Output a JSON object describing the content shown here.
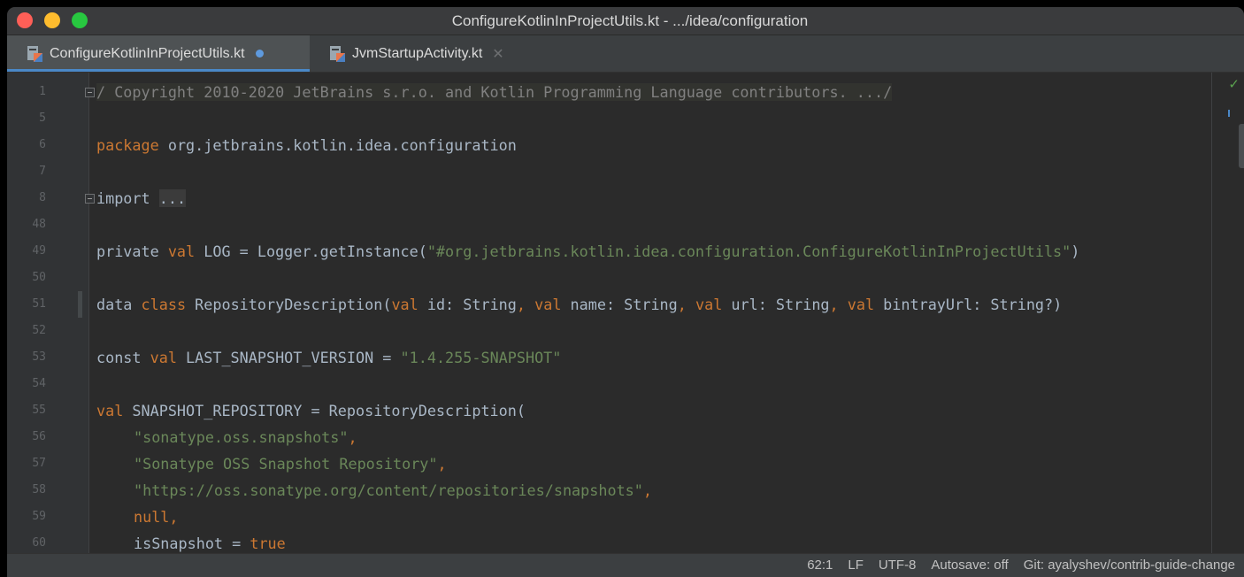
{
  "window": {
    "title": "ConfigureKotlinInProjectUtils.kt - .../idea/configuration"
  },
  "tabs": [
    {
      "label": "ConfigureKotlinInProjectUtils.kt",
      "active": true,
      "modified": true,
      "icon": "kotlin-file-icon"
    },
    {
      "label": "JvmStartupActivity.kt",
      "active": false,
      "icon": "kotlin-file-icon",
      "close_glyph": "✕"
    }
  ],
  "editor": {
    "line_numbers": [
      "1",
      "5",
      "6",
      "7",
      "8",
      "48",
      "49",
      "50",
      "51",
      "52",
      "53",
      "54",
      "55",
      "56",
      "57",
      "58",
      "59",
      "60"
    ],
    "lines": {
      "l1": "/ Copyright 2010-2020 JetBrains s.r.o. and Kotlin Programming Language contributors. .../",
      "l6_kw": "package",
      "l6_rest": " org.jetbrains.kotlin.idea.configuration",
      "l8_kw": "import",
      "l8_fold": "...",
      "l49_a": "private ",
      "l49_kw": "val",
      "l49_b": " LOG = Logger.getInstance(",
      "l49_str": "\"#org.jetbrains.kotlin.idea.configuration.ConfigureKotlinInProjectUtils\"",
      "l49_c": ")",
      "l51_a": "data ",
      "l51_kw1": "class",
      "l51_b": " RepositoryDescription(",
      "l51_kw2": "val",
      "l51_c": " id: String",
      "l51_comma1": ", ",
      "l51_kw3": "val",
      "l51_d": " name: String",
      "l51_comma2": ", ",
      "l51_kw4": "val",
      "l51_e": " url: String",
      "l51_comma3": ", ",
      "l51_kw5": "val",
      "l51_f": " bintrayUrl: String?)",
      "l53_a": "const ",
      "l53_kw": "val",
      "l53_b": " LAST_SNAPSHOT_VERSION = ",
      "l53_str": "\"1.4.255-SNAPSHOT\"",
      "l55_kw": "val",
      "l55_b": " SNAPSHOT_REPOSITORY = RepositoryDescription(",
      "l56_str": "\"sonatype.oss.snapshots\"",
      "l56_comma": ",",
      "l57_str": "\"Sonatype OSS Snapshot Repository\"",
      "l57_comma": ",",
      "l58_str": "\"https://oss.sonatype.org/content/repositories/snapshots\"",
      "l58_comma": ",",
      "l59_kw": "null",
      "l59_comma": ",",
      "l60_a": "isSnapshot = ",
      "l60_kw": "true"
    }
  },
  "statusbar": {
    "position": "62:1",
    "line_separator": "LF",
    "encoding": "UTF-8",
    "autosave": "Autosave: off",
    "git": "Git: ayalyshev/contrib-guide-change"
  },
  "colors": {
    "keyword": "#cc7832",
    "string": "#6a8759",
    "text": "#a9b7c6",
    "accent": "#4a88c7"
  }
}
